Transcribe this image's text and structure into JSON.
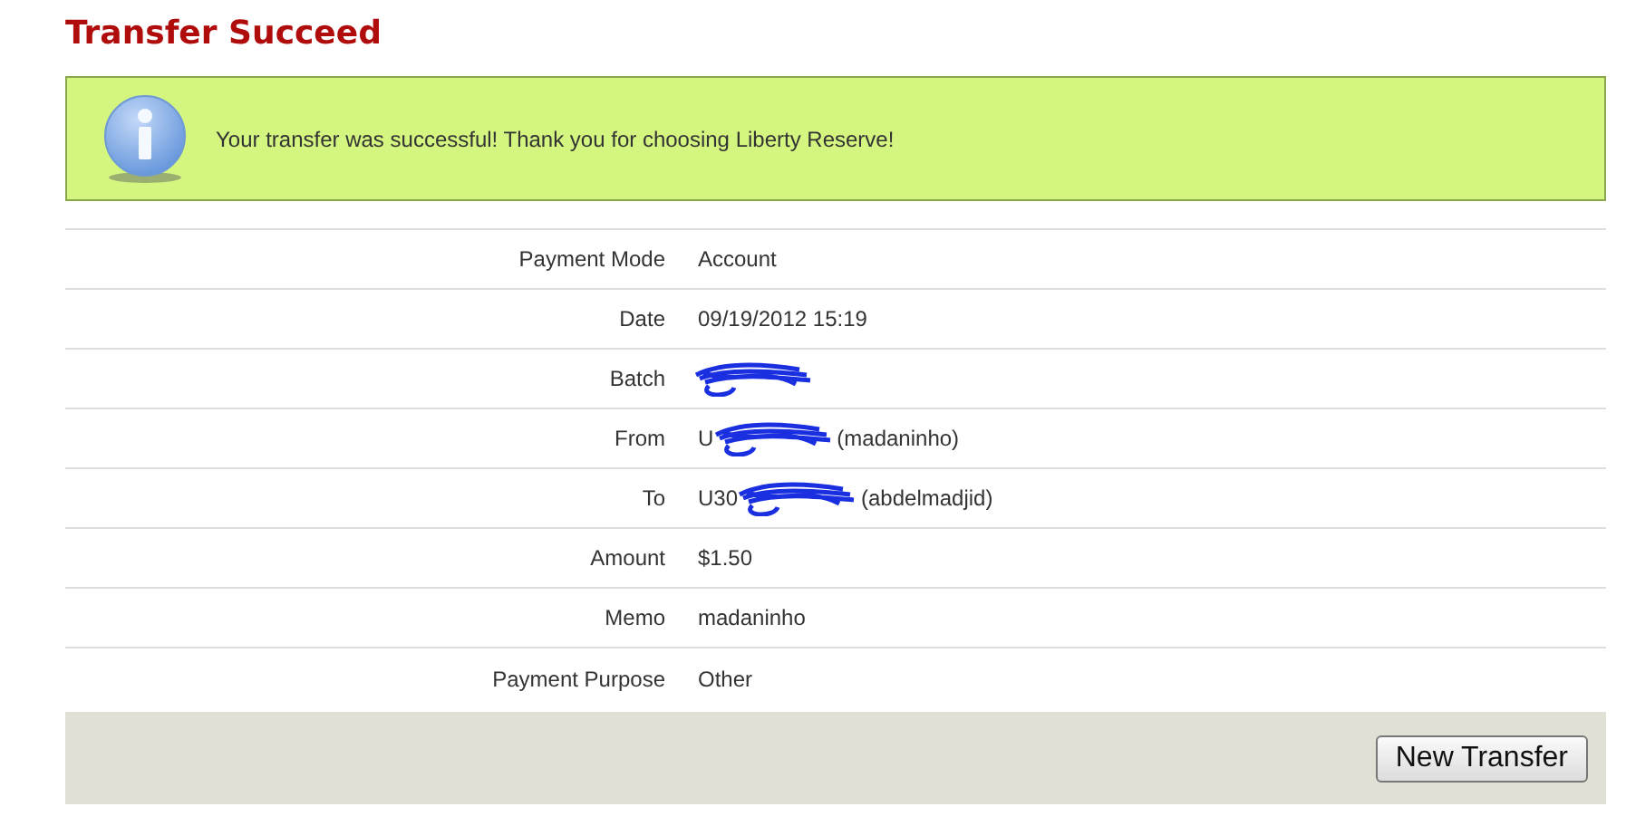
{
  "title": "Transfer Succeed",
  "message": "Your transfer was successful! Thank you for choosing Liberty Reserve!",
  "details": [
    {
      "label": "Payment Mode",
      "value": "Account"
    },
    {
      "label": "Date",
      "value": "09/19/2012 15:19"
    },
    {
      "label": "Batch",
      "redacted": true
    },
    {
      "label": "From",
      "value": "U",
      "redacted": true,
      "suffix": "(madaninho)"
    },
    {
      "label": "To",
      "value": "U30",
      "redacted": true,
      "suffix": "(abdelmadjid)"
    },
    {
      "label": "Amount",
      "value": "$1.50"
    },
    {
      "label": "Memo",
      "value": "madaninho"
    },
    {
      "label": "Payment Purpose",
      "value": "Other"
    }
  ],
  "button": "New Transfer"
}
